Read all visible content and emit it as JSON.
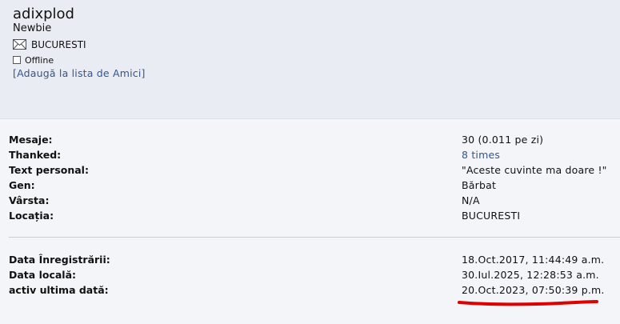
{
  "profile": {
    "username": "adixplod",
    "rank": "Newbie",
    "location": "BUCURESTI",
    "status": "Offline",
    "add_friend_link": "[Adaugă la lista de Amici]"
  },
  "stats": [
    {
      "label": "Mesaje:",
      "value": "30 (0.011 pe zi)"
    },
    {
      "label": "Thanked:",
      "value": "8 times"
    },
    {
      "label": "Text personal:",
      "value": "\"Aceste cuvinte ma doare !\""
    },
    {
      "label": "Gen:",
      "value": "Bărbat"
    },
    {
      "label": "Vârsta:",
      "value": "N/A"
    },
    {
      "label": "Locația:",
      "value": "BUCURESTI"
    }
  ],
  "dates": [
    {
      "label": "Data Înregistrării:",
      "value": "18.Oct.2017, 11:44:49 a.m."
    },
    {
      "label": "Data locală:",
      "value": "30.Iul.2025, 12:28:53 a.m."
    },
    {
      "label": "activ ultima dată:",
      "value": "20.Oct.2023, 07:50:39 p.m."
    }
  ],
  "icons": {
    "mail": "envelope-icon",
    "status": "checkbox-icon"
  },
  "colors": {
    "header_bg": "#e9edf3",
    "details_bg": "#f3f5f8",
    "link": "#34558b",
    "annotation": "#e00000"
  }
}
